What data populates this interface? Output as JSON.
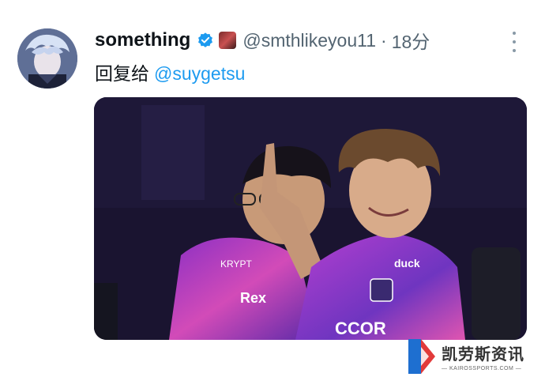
{
  "tweet": {
    "display_name": "something",
    "handle": "@smthlikeyou11",
    "separator": "·",
    "time": "18分",
    "reply_prefix": "回复给",
    "reply_mention": "@suygetsu"
  },
  "media": {
    "jersey_texts": [
      "Rex",
      "KRYPT",
      "duck",
      "CCOR"
    ]
  },
  "watermark": {
    "name": "凯劳斯资讯",
    "site": "— KAIROSSPORTS.COM —"
  },
  "colors": {
    "name_text": "#0f1419",
    "secondary_text": "#536471",
    "link_blue": "#1d9bf0",
    "verified_blue": "#1d9bf0",
    "jersey_purple": "#9b3cc8",
    "jersey_pink": "#e04bb5"
  },
  "icons": [
    "avatar",
    "verified-badge-icon",
    "emoji-badge-icon",
    "more-options-icon",
    "kairos-logo-icon"
  ]
}
